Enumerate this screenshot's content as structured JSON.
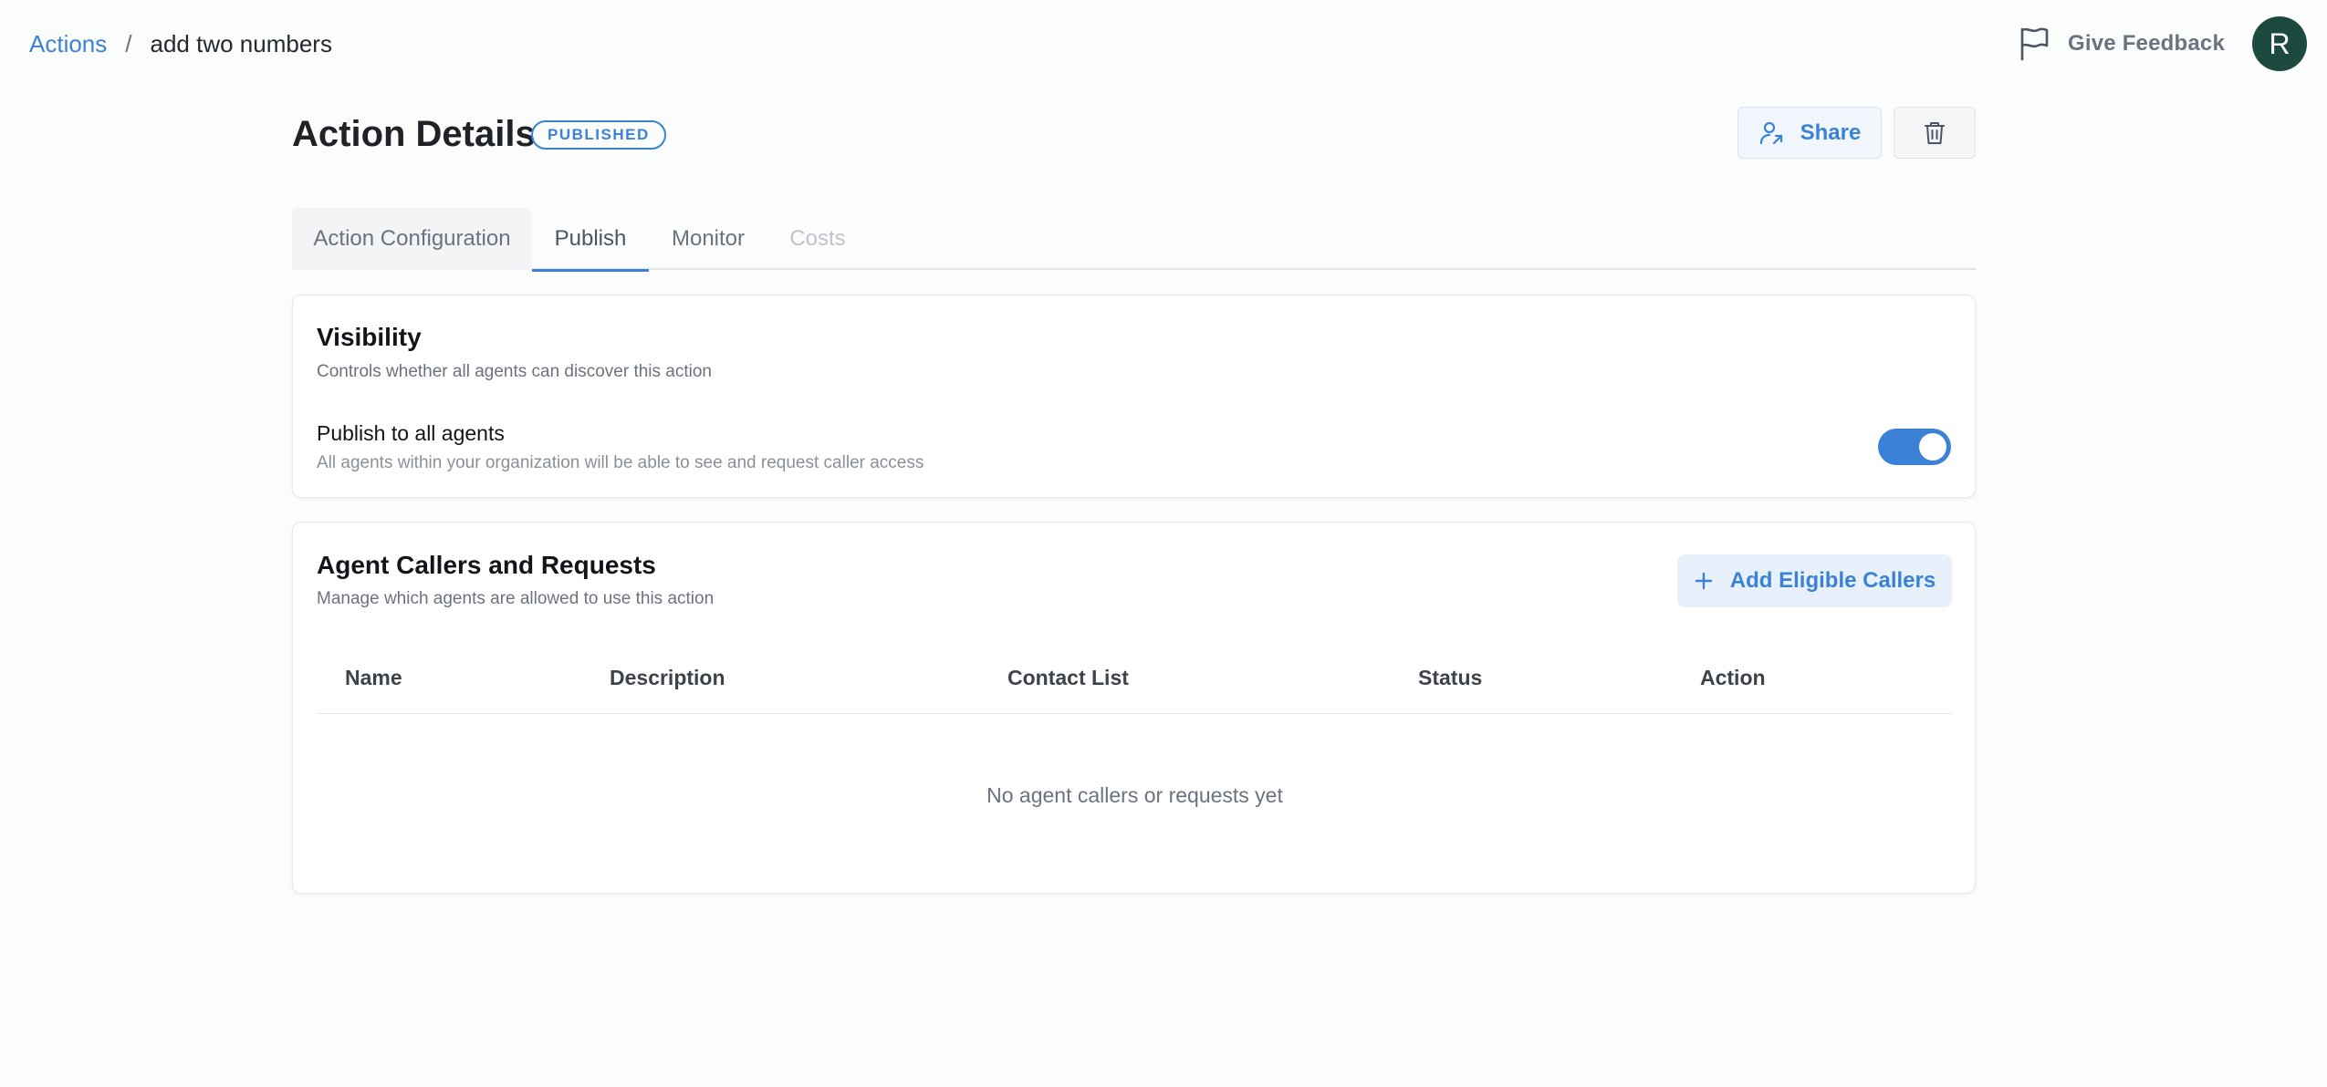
{
  "breadcrumb": {
    "parent": "Actions",
    "separator": "/",
    "current": "add two numbers"
  },
  "topbar": {
    "feedback_label": "Give Feedback",
    "feedback_icon": "flag-icon",
    "avatar_initial": "R",
    "avatar_color": "#1d4a3f"
  },
  "header": {
    "title": "Action Details",
    "status": "PUBLISHED",
    "share_label": "Share",
    "share_icon": "share-user-icon",
    "delete_icon": "trash-icon"
  },
  "tabs": [
    {
      "label": "Action Configuration"
    },
    {
      "label": "Publish",
      "active": true
    },
    {
      "label": "Monitor"
    },
    {
      "label": "Costs",
      "disabled": true
    }
  ],
  "visibility": {
    "title": "Visibility",
    "subtitle": "Controls whether all agents can discover this action",
    "publish_title": "Publish to all agents",
    "publish_subtitle": "All agents within your organization will be able to see and request caller access",
    "publish_enabled": true
  },
  "callers": {
    "title": "Agent Callers and Requests",
    "subtitle": "Manage which agents are allowed to use this action",
    "add_label": "Add Eligible Callers",
    "add_icon": "plus-icon",
    "columns": [
      "Name",
      "Description",
      "Contact List",
      "Status",
      "Action"
    ],
    "empty_text": "No agent callers or requests yet"
  },
  "colors": {
    "accent": "#3b82d6",
    "background": "#fbfcfc"
  }
}
